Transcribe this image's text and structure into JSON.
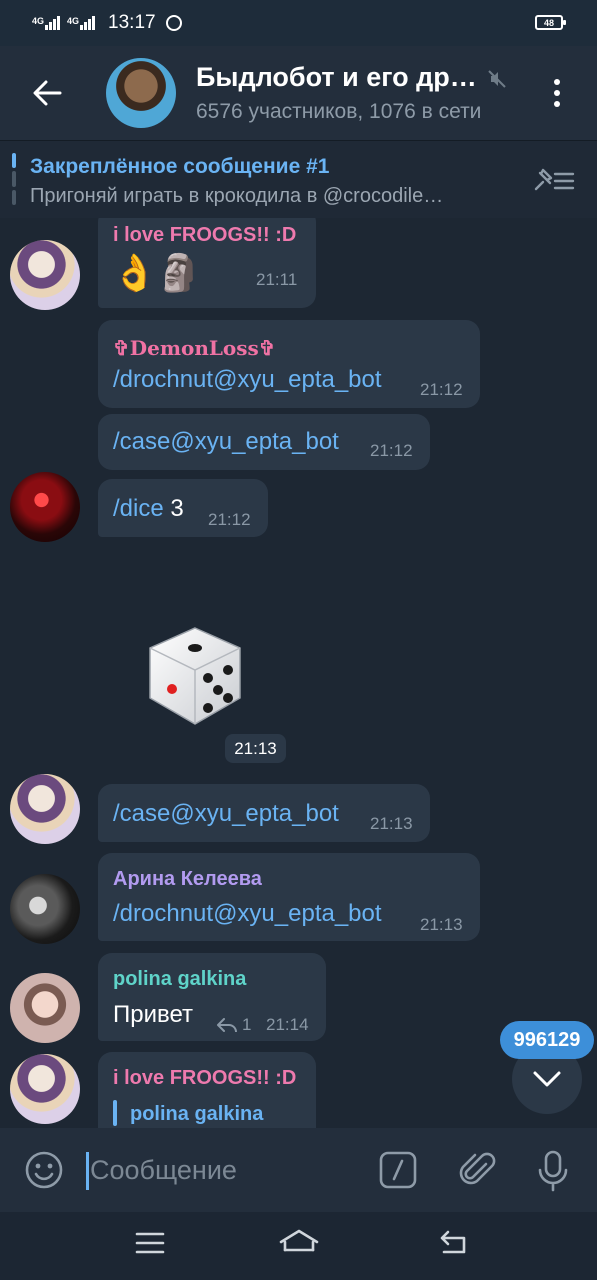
{
  "status_bar": {
    "net1": "4G",
    "net2": "4G",
    "time": "13:17",
    "battery": "48"
  },
  "header": {
    "title": "Быдлобот и его др…",
    "subtitle": "6576 участников, 1076 в сети"
  },
  "pinned": {
    "title": "Закреплённое сообщение #1",
    "text": "Пригоняй играть в крокодила в @crocodile…"
  },
  "messages": [
    {
      "sender": "i love FROOGS!! :D",
      "text": "👌🗿",
      "time": "21:11"
    },
    {
      "sender": "✞DemonLoss✞",
      "text": "/drochnut@xyu_epta_bot",
      "time": "21:12"
    },
    {
      "text": "/case@xyu_epta_bot",
      "time": "21:12"
    },
    {
      "cmd": "/dice",
      "arg": "3",
      "time": "21:12"
    },
    {
      "type": "dice",
      "value": 5,
      "time": "21:13"
    },
    {
      "text": "/case@xyu_epta_bot",
      "time": "21:13"
    },
    {
      "sender": "Арина Келеева",
      "text": "/drochnut@xyu_epta_bot",
      "time": "21:13"
    },
    {
      "sender": "polina galkina",
      "text": "Привет",
      "replies": "1",
      "time": "21:14"
    },
    {
      "sender": "i love FROOGS!! :D",
      "reply_to": "polina galkina"
    }
  ],
  "colors": {
    "sender_pink": "#ee7aae",
    "sender_demon": "#f072a4",
    "sender_purple": "#b29bf0",
    "sender_teal": "#5fd3c9",
    "link": "#6ab3f3"
  },
  "unread_count": "996129",
  "input": {
    "placeholder": "Сообщение"
  }
}
